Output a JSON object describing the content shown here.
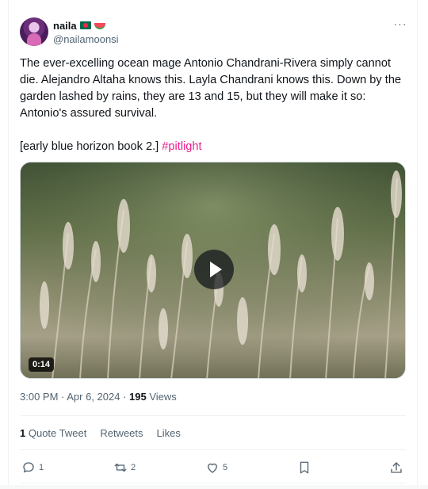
{
  "author": {
    "display_name": "naila",
    "handle": "@nailamoonsi",
    "badges": [
      "bangladesh-flag-emoji",
      "watermelon-emoji"
    ]
  },
  "more_menu": {
    "label": "···"
  },
  "tweet": {
    "paragraph_1": "The ever-excelling ocean mage Antonio Chandrani-Rivera simply cannot die. Alejandro Altaha knows this. Layla Chandrani knows this. Down by the garden lashed by rains, they are 13 and 15, but they will make it so: Antonio's assured survival.",
    "paragraph_2_text": "[early blue horizon book 2.] ",
    "hashtag": "#pitlight"
  },
  "media": {
    "type": "video",
    "duration": "0:14"
  },
  "meta": {
    "time_date": "3:00 PM · Apr 6, 2024 · ",
    "views_count": "195",
    "views_label": " Views"
  },
  "stats": {
    "quote_count": "1",
    "quote_label": " Quote Tweet",
    "retweets_label": "Retweets",
    "likes_label": "Likes"
  },
  "actions": {
    "reply_count": "1",
    "retweet_count": "2",
    "like_count": "5"
  },
  "colors": {
    "accent_hashtag": "#e91e8c",
    "text_primary": "#0f1419",
    "text_secondary": "#536471"
  }
}
